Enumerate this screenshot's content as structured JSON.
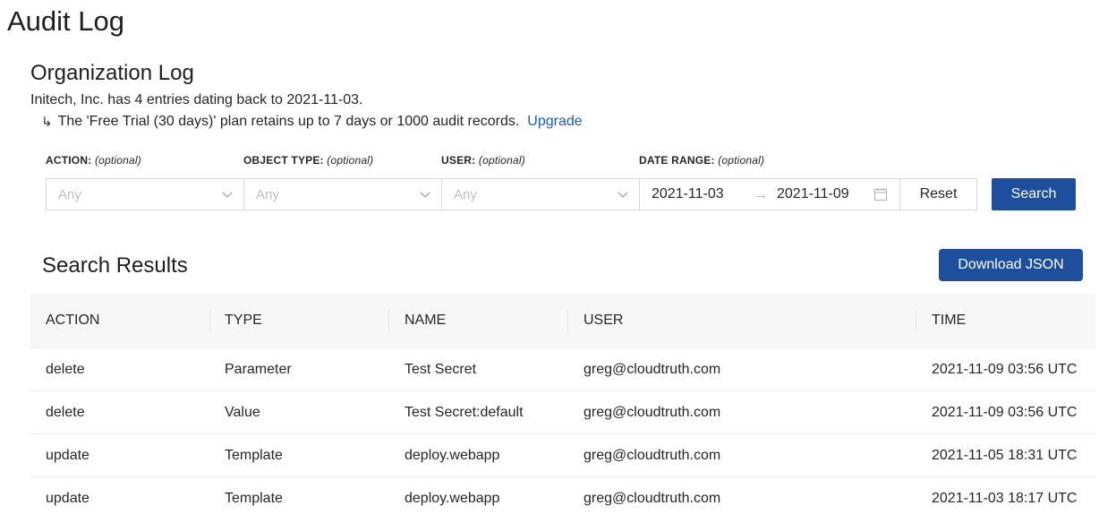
{
  "page": {
    "title": "Audit Log"
  },
  "org": {
    "section_title": "Organization Log",
    "summary": "Initech, Inc. has 4 entries dating back to 2021-11-03.",
    "retention": "The 'Free Trial (30 days)' plan retains up to 7 days or 1000 audit records.",
    "upgrade_link": "Upgrade"
  },
  "filters": {
    "action": {
      "label": "ACTION:",
      "hint": "(optional)",
      "placeholder": "Any"
    },
    "object_type": {
      "label": "OBJECT TYPE:",
      "hint": "(optional)",
      "placeholder": "Any"
    },
    "user": {
      "label": "USER:",
      "hint": "(optional)",
      "placeholder": "Any"
    },
    "date_range": {
      "label": "DATE RANGE:",
      "hint": "(optional)",
      "start": "2021-11-03",
      "separator": "→",
      "end": "2021-11-09"
    },
    "reset_label": "Reset",
    "search_label": "Search"
  },
  "results": {
    "title": "Search Results",
    "download_label": "Download JSON",
    "columns": [
      "ACTION",
      "TYPE",
      "NAME",
      "USER",
      "TIME"
    ],
    "rows": [
      {
        "action": "delete",
        "type": "Parameter",
        "name": "Test Secret",
        "user": "greg@cloudtruth.com",
        "time": "2021-11-09 03:56 UTC"
      },
      {
        "action": "delete",
        "type": "Value",
        "name": "Test Secret:default",
        "user": "greg@cloudtruth.com",
        "time": "2021-11-09 03:56 UTC"
      },
      {
        "action": "update",
        "type": "Template",
        "name": "deploy.webapp",
        "user": "greg@cloudtruth.com",
        "time": "2021-11-05 18:31 UTC"
      },
      {
        "action": "update",
        "type": "Template",
        "name": "deploy.webapp",
        "user": "greg@cloudtruth.com",
        "time": "2021-11-03 18:17 UTC"
      }
    ]
  },
  "icons": {
    "dropdown": "chevron-down-icon",
    "calendar": "calendar-icon",
    "retention_arrow": "return-arrow-icon"
  },
  "colors": {
    "primary": "#1d4f9e",
    "link": "#1f5ab3",
    "header_bg": "#f7f7f7"
  }
}
